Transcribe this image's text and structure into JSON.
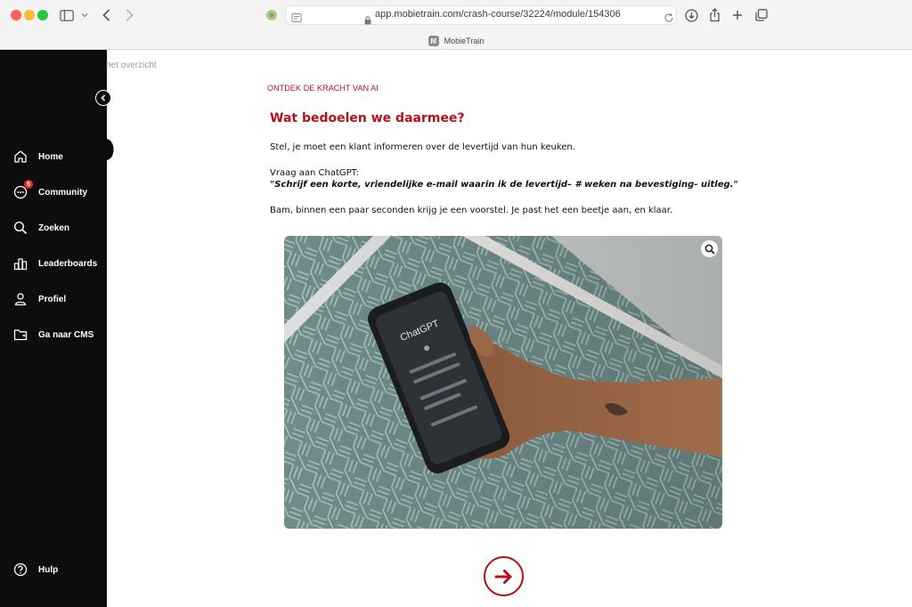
{
  "browser": {
    "url": "app.mobietrain.com/crash-course/32224/module/154306",
    "tab_title": "MobieTrain",
    "tab_favicon_letter": "M"
  },
  "sidebar": {
    "items": [
      {
        "label": "Home",
        "icon": "home-icon"
      },
      {
        "label": "Community",
        "icon": "community-icon",
        "badge": "5"
      },
      {
        "label": "Zoeken",
        "icon": "search-icon"
      },
      {
        "label": "Leaderboards",
        "icon": "leaderboard-icon"
      },
      {
        "label": "Profiel",
        "icon": "profile-icon"
      },
      {
        "label": "Ga naar CMS",
        "icon": "folder-icon"
      }
    ],
    "help_label": "Hulp"
  },
  "content": {
    "back_link": "het overzicht",
    "eyebrow": "ONTDEK DE KRACHT VAN AI",
    "heading": "Wat bedoelen we daarmee?",
    "intro": "Stel, je moet een klant informeren over de levertijd van hun keuken.",
    "ask_label": "Vraag aan ChatGPT:",
    "prompt_quote": "\"Schrijf een korte, vriendelijke e-mail waarin ik de levertijd– # weken na bevestiging- uitleg.\"",
    "outcome": "Bam, binnen een paar seconden krijg je een voorstel. Je past het een beetje aan, en klaar.",
    "image_phone_text": "ChatGPT"
  },
  "colors": {
    "accent": "#b3121b",
    "sidebar_bg": "#0d0d0d"
  }
}
